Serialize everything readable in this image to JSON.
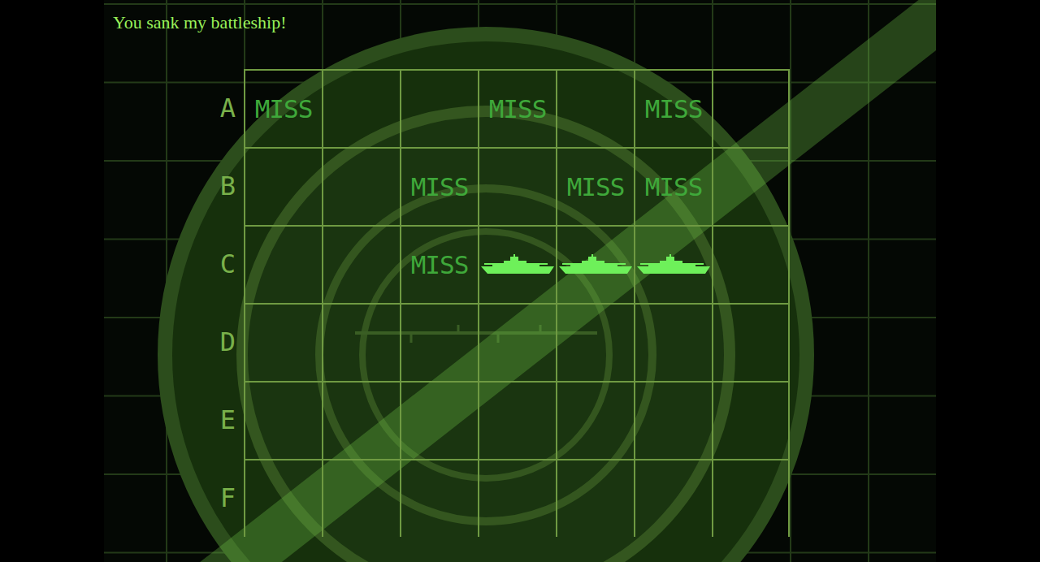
{
  "message": "You sank my battleship!",
  "board": {
    "rows": [
      {
        "label": "A",
        "cells": [
          {
            "kind": "miss",
            "text": "MISS"
          },
          {
            "kind": "empty"
          },
          {
            "kind": "empty"
          },
          {
            "kind": "miss",
            "text": "MISS"
          },
          {
            "kind": "empty"
          },
          {
            "kind": "miss",
            "text": "MISS"
          },
          {
            "kind": "empty"
          }
        ]
      },
      {
        "label": "B",
        "cells": [
          {
            "kind": "empty"
          },
          {
            "kind": "empty"
          },
          {
            "kind": "miss",
            "text": "MISS"
          },
          {
            "kind": "empty"
          },
          {
            "kind": "miss",
            "text": "MISS"
          },
          {
            "kind": "miss",
            "text": "MISS"
          },
          {
            "kind": "empty"
          }
        ]
      },
      {
        "label": "C",
        "cells": [
          {
            "kind": "empty"
          },
          {
            "kind": "empty"
          },
          {
            "kind": "miss",
            "text": "MISS"
          },
          {
            "kind": "ship"
          },
          {
            "kind": "ship"
          },
          {
            "kind": "ship"
          },
          {
            "kind": "empty"
          }
        ]
      },
      {
        "label": "D",
        "cells": [
          {
            "kind": "empty"
          },
          {
            "kind": "empty"
          },
          {
            "kind": "empty"
          },
          {
            "kind": "empty"
          },
          {
            "kind": "empty"
          },
          {
            "kind": "empty"
          },
          {
            "kind": "empty"
          }
        ]
      },
      {
        "label": "E",
        "cells": [
          {
            "kind": "empty"
          },
          {
            "kind": "empty"
          },
          {
            "kind": "empty"
          },
          {
            "kind": "empty"
          },
          {
            "kind": "empty"
          },
          {
            "kind": "empty"
          },
          {
            "kind": "empty"
          }
        ]
      },
      {
        "label": "F",
        "cells": [
          {
            "kind": "empty"
          },
          {
            "kind": "empty"
          },
          {
            "kind": "empty"
          },
          {
            "kind": "empty"
          },
          {
            "kind": "empty"
          },
          {
            "kind": "empty"
          },
          {
            "kind": "empty"
          }
        ]
      }
    ]
  }
}
